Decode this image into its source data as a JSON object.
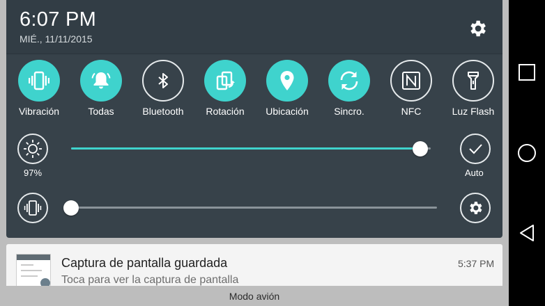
{
  "status": {
    "time": "6:07 PM",
    "date": "MIÉ., 11/11/2015"
  },
  "toggles": [
    {
      "label": "Vibración",
      "icon": "vibrate-icon",
      "on": true
    },
    {
      "label": "Todas",
      "icon": "bell-icon",
      "on": true
    },
    {
      "label": "Bluetooth",
      "icon": "bluetooth-icon",
      "on": false
    },
    {
      "label": "Rotación",
      "icon": "rotation-icon",
      "on": true
    },
    {
      "label": "Ubicación",
      "icon": "location-icon",
      "on": true
    },
    {
      "label": "Sincro.",
      "icon": "sync-icon",
      "on": true
    },
    {
      "label": "NFC",
      "icon": "nfc-icon",
      "on": false
    },
    {
      "label": "Luz Flash",
      "icon": "flashlight-icon",
      "on": false
    }
  ],
  "brightness": {
    "value_label": "97%",
    "level": 0.97,
    "auto_label": "Auto"
  },
  "volume": {
    "level": 0.0
  },
  "notification": {
    "title": "Captura de pantalla guardada",
    "subtitle": "Toca para ver la captura de pantalla",
    "time": "5:37 PM"
  },
  "bottom_status": "Modo avión",
  "colors": {
    "accent": "#3fd3cd",
    "panel": "#37424a",
    "header": "#323d45",
    "slider_track_muted": "#8a9399"
  }
}
